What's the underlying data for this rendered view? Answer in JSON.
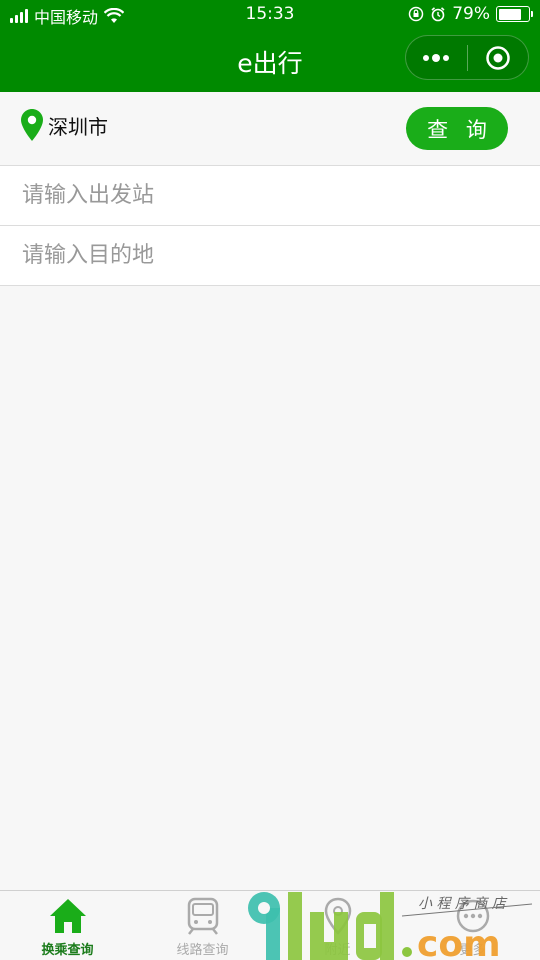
{
  "status_bar": {
    "carrier": "中国移动",
    "time": "15:33",
    "battery": "79%",
    "battery_level": 0.79
  },
  "nav": {
    "title": "e出行"
  },
  "search": {
    "city": "深圳市",
    "query_label": "查 询",
    "from_placeholder": "请输入出发站",
    "to_placeholder": "请输入目的地"
  },
  "tabbar": {
    "items": [
      {
        "label": "换乘查询",
        "icon": "home-icon",
        "active": true
      },
      {
        "label": "线路查询",
        "icon": "train-icon",
        "active": false
      },
      {
        "label": "附近",
        "icon": "location-icon",
        "active": false
      },
      {
        "label": "更多",
        "icon": "more-icon",
        "active": false
      }
    ]
  },
  "watermark": {
    "logo_text": "91ud.com",
    "tagline": "小程序商店"
  },
  "colors": {
    "brand_green": "#008a00",
    "button_green": "#1aad19",
    "tab_active": "#1c7c1c",
    "tab_inactive": "#aaaaaa"
  }
}
